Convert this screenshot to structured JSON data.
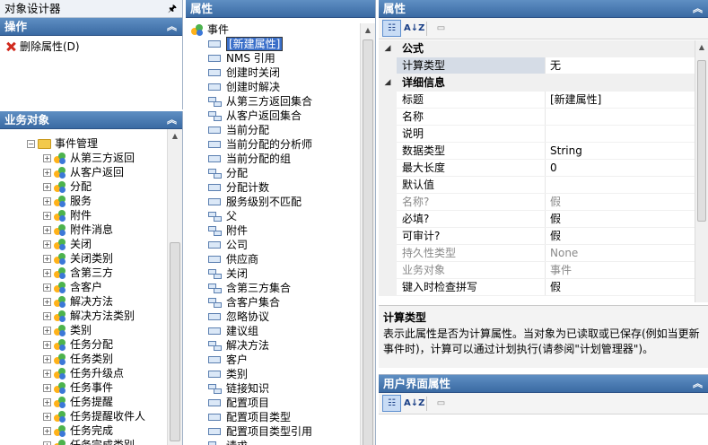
{
  "designer": {
    "title": "对象设计器",
    "pin_glyph": "🖈",
    "actions_header": "操作",
    "actions": [
      {
        "label": "删除属性(D)"
      }
    ]
  },
  "business": {
    "header": "业务对象",
    "root": "事件管理",
    "items": [
      "从第三方返回",
      "从客户返回",
      "分配",
      "服务",
      "附件",
      "附件消息",
      "关闭",
      "关闭类别",
      "含第三方",
      "含客户",
      "解决方法",
      "解决方法类别",
      "类别",
      "任务分配",
      "任务类别",
      "任务升级点",
      "任务事件",
      "任务提醒",
      "任务提醒收件人",
      "任务完成",
      "任务完成类别"
    ]
  },
  "attributes": {
    "header": "属性",
    "root": "事件",
    "items": [
      {
        "label": "[新建属性]",
        "kind": "single",
        "selected": true
      },
      {
        "label": "NMS 引用",
        "kind": "single"
      },
      {
        "label": "创建时关闭",
        "kind": "single"
      },
      {
        "label": "创建时解决",
        "kind": "single"
      },
      {
        "label": "从第三方返回集合",
        "kind": "coll"
      },
      {
        "label": "从客户返回集合",
        "kind": "coll"
      },
      {
        "label": "当前分配",
        "kind": "single"
      },
      {
        "label": "当前分配的分析师",
        "kind": "single"
      },
      {
        "label": "当前分配的组",
        "kind": "single"
      },
      {
        "label": "分配",
        "kind": "coll"
      },
      {
        "label": "分配计数",
        "kind": "single"
      },
      {
        "label": "服务级别不匹配",
        "kind": "single"
      },
      {
        "label": "父",
        "kind": "coll"
      },
      {
        "label": "附件",
        "kind": "coll"
      },
      {
        "label": "公司",
        "kind": "single"
      },
      {
        "label": "供应商",
        "kind": "single"
      },
      {
        "label": "关闭",
        "kind": "coll"
      },
      {
        "label": "含第三方集合",
        "kind": "coll"
      },
      {
        "label": "含客户集合",
        "kind": "coll"
      },
      {
        "label": "忽略协议",
        "kind": "single"
      },
      {
        "label": "建议组",
        "kind": "single"
      },
      {
        "label": "解决方法",
        "kind": "coll"
      },
      {
        "label": "客户",
        "kind": "single"
      },
      {
        "label": "类别",
        "kind": "single"
      },
      {
        "label": "链接知识",
        "kind": "coll"
      },
      {
        "label": "配置项目",
        "kind": "single"
      },
      {
        "label": "配置项目类型",
        "kind": "single"
      },
      {
        "label": "配置项目类型引用",
        "kind": "single"
      },
      {
        "label": "请求",
        "kind": "coll"
      }
    ]
  },
  "properties": {
    "header": "属性",
    "toolbar": {
      "sort_glyph": "A↓Z"
    },
    "categories": [
      {
        "name": "公式",
        "rows": [
          {
            "name": "计算类型",
            "value": "无",
            "selected": true
          }
        ]
      },
      {
        "name": "详细信息",
        "rows": [
          {
            "name": "标题",
            "value": "[新建属性]"
          },
          {
            "name": "名称",
            "value": ""
          },
          {
            "name": "说明",
            "value": ""
          },
          {
            "name": "数据类型",
            "value": "String"
          },
          {
            "name": "最大长度",
            "value": "0"
          },
          {
            "name": "默认值",
            "value": ""
          },
          {
            "name": "名称?",
            "value": "假",
            "dim": true
          },
          {
            "name": "必填?",
            "value": "假"
          },
          {
            "name": "可审计?",
            "value": "假"
          },
          {
            "name": "持久性类型",
            "value": "None",
            "dim": true
          },
          {
            "name": "业务对象",
            "value": "事件",
            "dim": true
          },
          {
            "name": "键入时检查拼写",
            "value": "假"
          }
        ]
      }
    ],
    "description": {
      "title": "计算类型",
      "text": "表示此属性是否为计算属性。当对象为已读取或已保存(例如当更新事件时)，计算可以通过计划执行(请参阅\"计划管理器\")。"
    }
  },
  "ui_props": {
    "header": "用户界面属性"
  }
}
